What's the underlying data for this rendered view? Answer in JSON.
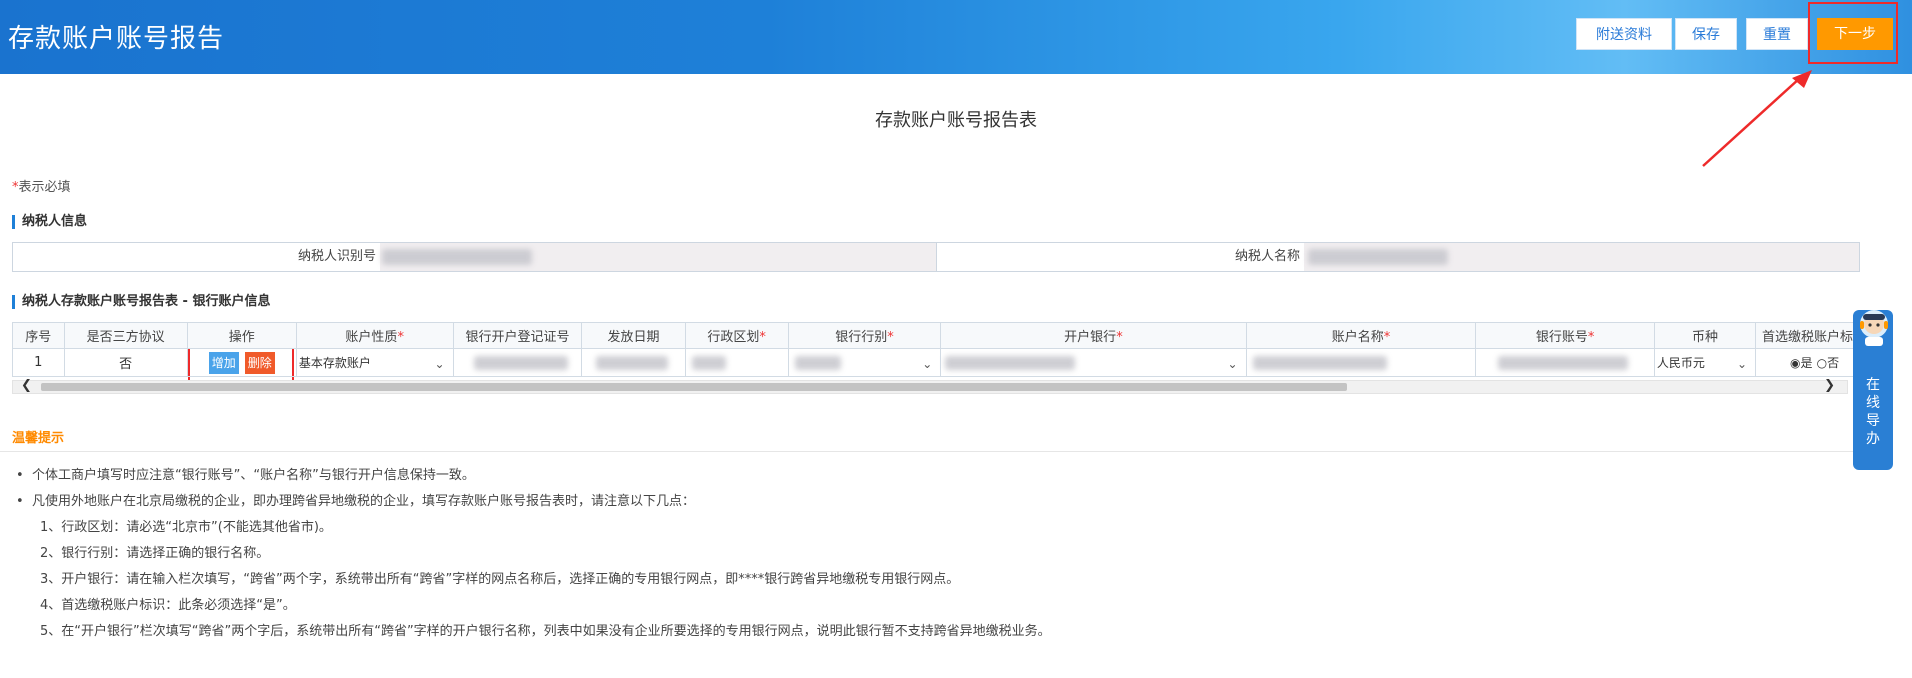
{
  "header": {
    "title": "存款账户账号报告",
    "buttons": {
      "attach": "附送资料",
      "save": "保存",
      "reset": "重置",
      "next": "下一步"
    }
  },
  "form_title": "存款账户账号报告表",
  "required_note": {
    "star": "*",
    "text": "表示必填"
  },
  "taxpayer_section": {
    "heading": "纳税人信息",
    "id_label": "纳税人识别号",
    "name_label": "纳税人名称"
  },
  "account_section": {
    "heading": "纳税人存款账户账号报告表 - 银行账户信息",
    "columns": [
      {
        "label": "序号",
        "required": false
      },
      {
        "label": "是否三方协议",
        "required": false
      },
      {
        "label": "操作",
        "required": false
      },
      {
        "label": "账户性质",
        "required": true
      },
      {
        "label": "银行开户登记证号",
        "required": false
      },
      {
        "label": "发放日期",
        "required": false
      },
      {
        "label": "行政区划",
        "required": true
      },
      {
        "label": "银行行别",
        "required": true
      },
      {
        "label": "开户银行",
        "required": true
      },
      {
        "label": "账户名称",
        "required": true
      },
      {
        "label": "银行账号",
        "required": true
      },
      {
        "label": "币种",
        "required": false
      },
      {
        "label": "首选缴税账户标",
        "required": false
      }
    ],
    "row": {
      "index": "1",
      "tripartite": "否",
      "add_label": "增加",
      "delete_label": "删除",
      "account_type": "基本存款账户",
      "currency": "人民币元",
      "preferred_yes": "是",
      "preferred_no": "否",
      "preferred_selected": "是"
    }
  },
  "tips": {
    "heading": "温馨提示",
    "bullets": [
      "个体工商户填写时应注意“银行账号”、“账户名称”与银行开户信息保持一致。",
      "凡使用外地账户在北京局缴税的企业，即办理跨省异地缴税的企业，填写存款账户账号报告表时，请注意以下几点："
    ],
    "items": [
      "1、行政区划：请必选“北京市”(不能选其他省市)。",
      "2、银行行别：请选择正确的银行名称。",
      "3、开户银行：请在输入栏次填写，“跨省”两个字，系统带出所有“跨省”字样的网点名称后，选择正确的专用银行网点，即****银行跨省异地缴税专用银行网点。",
      "4、首选缴税账户标识：此条必须选择“是”。",
      "5、在“开户银行”栏次填写“跨省”两个字后，系统带出所有“跨省”字样的开户银行名称，列表中如果没有企业所要选择的专用银行网点，说明此银行暂不支持跨省异地缴税业务。"
    ]
  },
  "float_help": {
    "text": "在线导办"
  },
  "colors": {
    "header_blue": "#1a73cf",
    "next_orange": "#ff9900",
    "annotation_red": "#ee2a2a",
    "tips_orange": "#ff8a00"
  }
}
